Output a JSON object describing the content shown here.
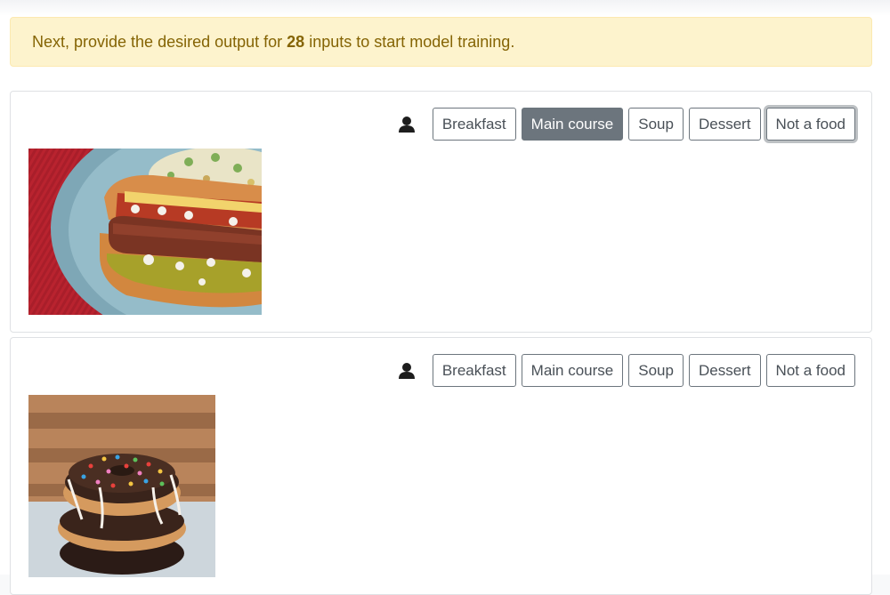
{
  "alert": {
    "prefix": "Next, provide the desired output for",
    "count": "28",
    "suffix": "inputs to start model training."
  },
  "label_options": [
    "Breakfast",
    "Main course",
    "Soup",
    "Dessert",
    "Not a food"
  ],
  "items": [
    {
      "image": "hot-dog-photo",
      "selected": "Main course",
      "focused": "Not a food"
    },
    {
      "image": "donuts-photo",
      "selected": null,
      "focused": null
    }
  ],
  "colors": {
    "alert_bg": "#fdf3cd",
    "alert_text": "#856404",
    "button_border": "#6c757d",
    "active_bg": "#6c757d"
  }
}
